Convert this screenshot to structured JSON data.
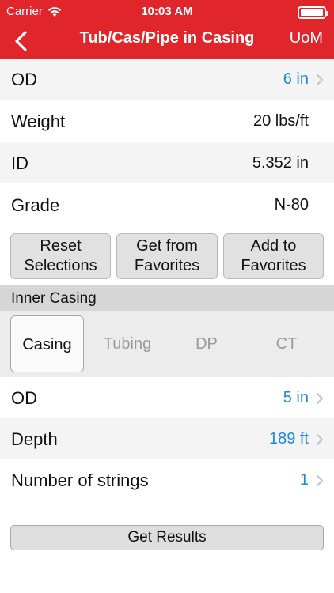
{
  "status_bar": {
    "carrier": "Carrier",
    "time": "10:03 AM"
  },
  "nav": {
    "title": "Tub/Cas/Pipe in Casing",
    "right_button": "UoM",
    "back_icon": "chevron-left-icon"
  },
  "pipe": {
    "od": {
      "label": "OD",
      "value": "6 in"
    },
    "weight": {
      "label": "Weight",
      "value": "20 lbs/ft"
    },
    "id": {
      "label": "ID",
      "value": "5.352 in"
    },
    "grade": {
      "label": "Grade",
      "value": "N-80"
    }
  },
  "actions": {
    "reset_line1": "Reset",
    "reset_line2": "Selections",
    "get_line1": "Get from",
    "get_line2": "Favorites",
    "add_line1": "Add to",
    "add_line2": "Favorites"
  },
  "inner_casing": {
    "header": "Inner Casing",
    "tabs": [
      "Casing",
      "Tubing",
      "DP",
      "CT"
    ],
    "selected_tab": "Casing",
    "od": {
      "label": "OD",
      "value": "5 in"
    },
    "depth": {
      "label": "Depth",
      "value": "189 ft"
    },
    "strings": {
      "label": "Number of strings",
      "value": "1"
    }
  },
  "results_button": "Get Results",
  "colors": {
    "header": "#e0252b",
    "link_value": "#1e88e5",
    "section_bg": "#d6d6d6"
  }
}
